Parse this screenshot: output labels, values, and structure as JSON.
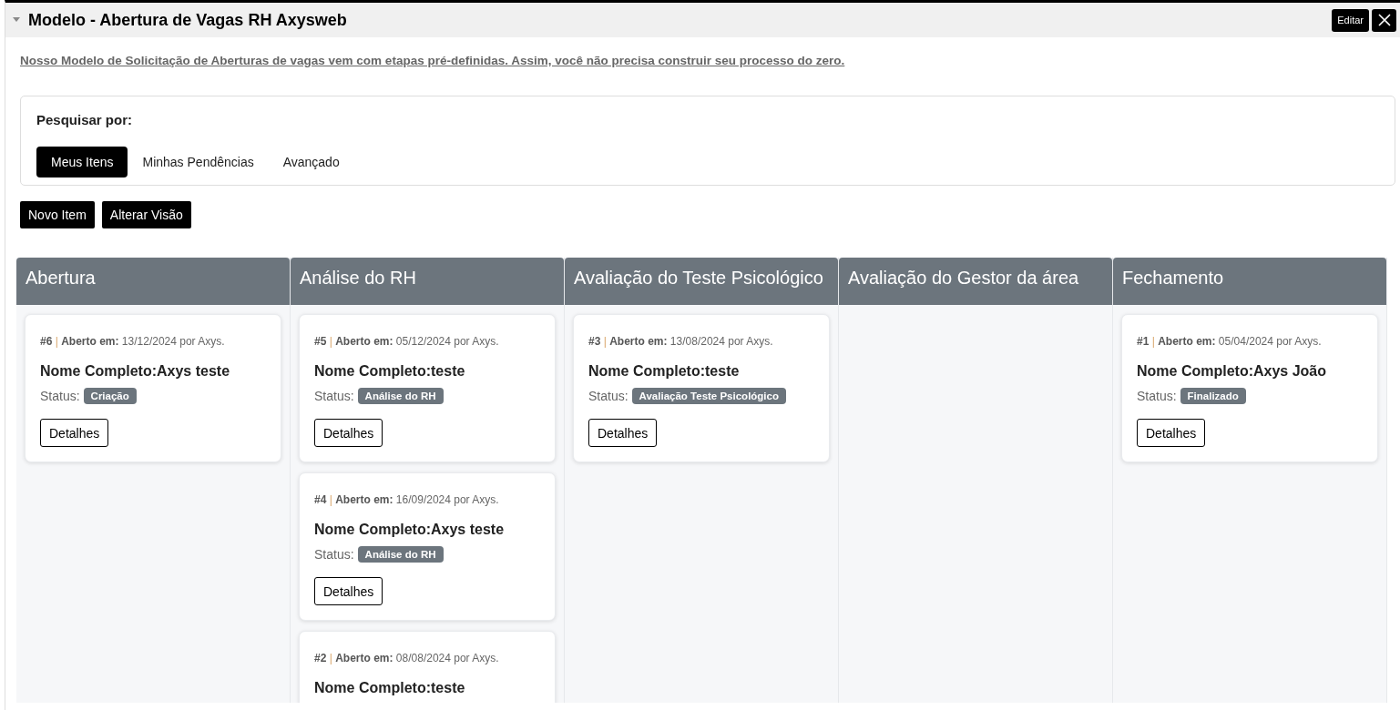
{
  "window": {
    "title": "Modelo - Abertura de Vagas RH Axysweb",
    "expanded": true,
    "buttons": [
      {
        "kind": "text",
        "label": "Editar"
      },
      {
        "kind": "close"
      }
    ]
  },
  "description": "Nosso Modelo de Solicitação de Aberturas de vagas vem com etapas pré-definidas. Assim, você não precisa construir seu processo do zero.",
  "search": {
    "label": "Pesquisar por:",
    "tabs": [
      {
        "label": "Meus Itens",
        "selected": true
      },
      {
        "label": "Minhas Pendências",
        "selected": false
      },
      {
        "label": "Avançado",
        "selected": false
      }
    ]
  },
  "actions": [
    "Novo Item",
    "Alterar Visão"
  ],
  "columns": [
    {
      "title": "Abertura",
      "cards": [
        {
          "number": "#6",
          "separator": "|",
          "opened_label": "Aberto em:",
          "opened": "13/12/2024 por Axys.",
          "name": "Nome Completo:Axys teste",
          "status_label": "Status:",
          "status": "Criação",
          "button": "Detalhes"
        }
      ]
    },
    {
      "title": "Análise do RH",
      "cards": [
        {
          "number": "#5",
          "separator": "|",
          "opened_label": "Aberto em:",
          "opened": "05/12/2024 por Axys.",
          "name": "Nome Completo:teste",
          "status_label": "Status:",
          "status": "Análise do RH",
          "button": "Detalhes"
        },
        {
          "number": "#4",
          "separator": "|",
          "opened_label": "Aberto em:",
          "opened": "16/09/2024 por Axys.",
          "name": "Nome Completo:Axys teste",
          "status_label": "Status:",
          "status": "Análise do RH",
          "button": "Detalhes"
        },
        {
          "number": "#2",
          "separator": "|",
          "opened_label": "Aberto em:",
          "opened": "08/08/2024 por Axys.",
          "name": "Nome Completo:teste"
        }
      ]
    },
    {
      "title": "Avaliação do Teste Psicológico",
      "cards": [
        {
          "number": "#3",
          "separator": "|",
          "opened_label": "Aberto em:",
          "opened": "13/08/2024 por Axys.",
          "name": "Nome Completo:teste",
          "status_label": "Status:",
          "status": "Avaliação Teste Psicológico",
          "button": "Detalhes"
        }
      ]
    },
    {
      "title": "Avaliação do Gestor da área"
    },
    {
      "title": "Fechamento",
      "cards": [
        {
          "number": "#1",
          "separator": "|",
          "opened_label": "Aberto em:",
          "opened": "05/04/2024 por Axys.",
          "name": "Nome Completo:Axys João",
          "status_label": "Status:",
          "status": "Finalizado",
          "button": "Detalhes"
        }
      ]
    }
  ]
}
